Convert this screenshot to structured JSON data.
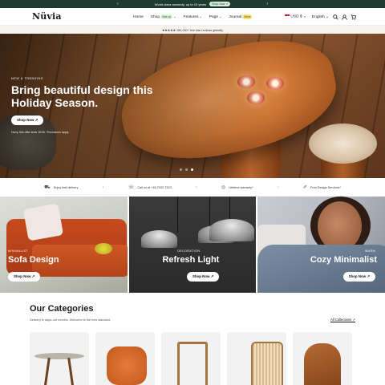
{
  "announcement": {
    "text": "World class warranty, up to 10 years",
    "cta": "Shop Now ↗"
  },
  "header": {
    "logo": "Nüvia",
    "nav": [
      {
        "label": "Home"
      },
      {
        "label": "Shop",
        "badge": "Sale up"
      },
      {
        "label": "Features"
      },
      {
        "label": "Page"
      },
      {
        "label": "Journal",
        "badge": "News"
      }
    ],
    "currency": "USD $",
    "language": "English"
  },
  "reviews": {
    "text": "★★★★★ 150,000+ five star reviews globally"
  },
  "hero": {
    "kicker": "NEW & TRENDING",
    "title": "Bring beautiful design this Holiday Season.",
    "cta": "Shop Now ↗",
    "note": "Hurry, this offer ends 15:00. *Exclusions apply."
  },
  "features": [
    {
      "icon": "fast-delivery-icon",
      "label": "Enjoy fast delivery"
    },
    {
      "icon": "phone-icon",
      "label": "Call us at +45 7020 7323"
    },
    {
      "icon": "warranty-icon",
      "label": "Lifetime warranty*"
    },
    {
      "icon": "design-service-icon",
      "label": "Free Design Services*"
    }
  ],
  "panels": [
    {
      "kicker": "MINIMALIST",
      "title": "Sofa Design",
      "cta": "Shop Now ↗"
    },
    {
      "kicker": "DECORATION",
      "title": "Refresh Light",
      "cta": "Shop Now ↗"
    },
    {
      "kicker": "WARM",
      "title": "Cozy Minimalist",
      "cta": "Shop Now ↗"
    }
  ],
  "categories": {
    "title": "Our Categories",
    "subtitle": "Delivery in days–not months. Welcome to the new standard.",
    "all_link": "All Collections ↗"
  },
  "colors": {
    "announce_bg": "#1f3a30",
    "accent": "#dcefd9"
  }
}
